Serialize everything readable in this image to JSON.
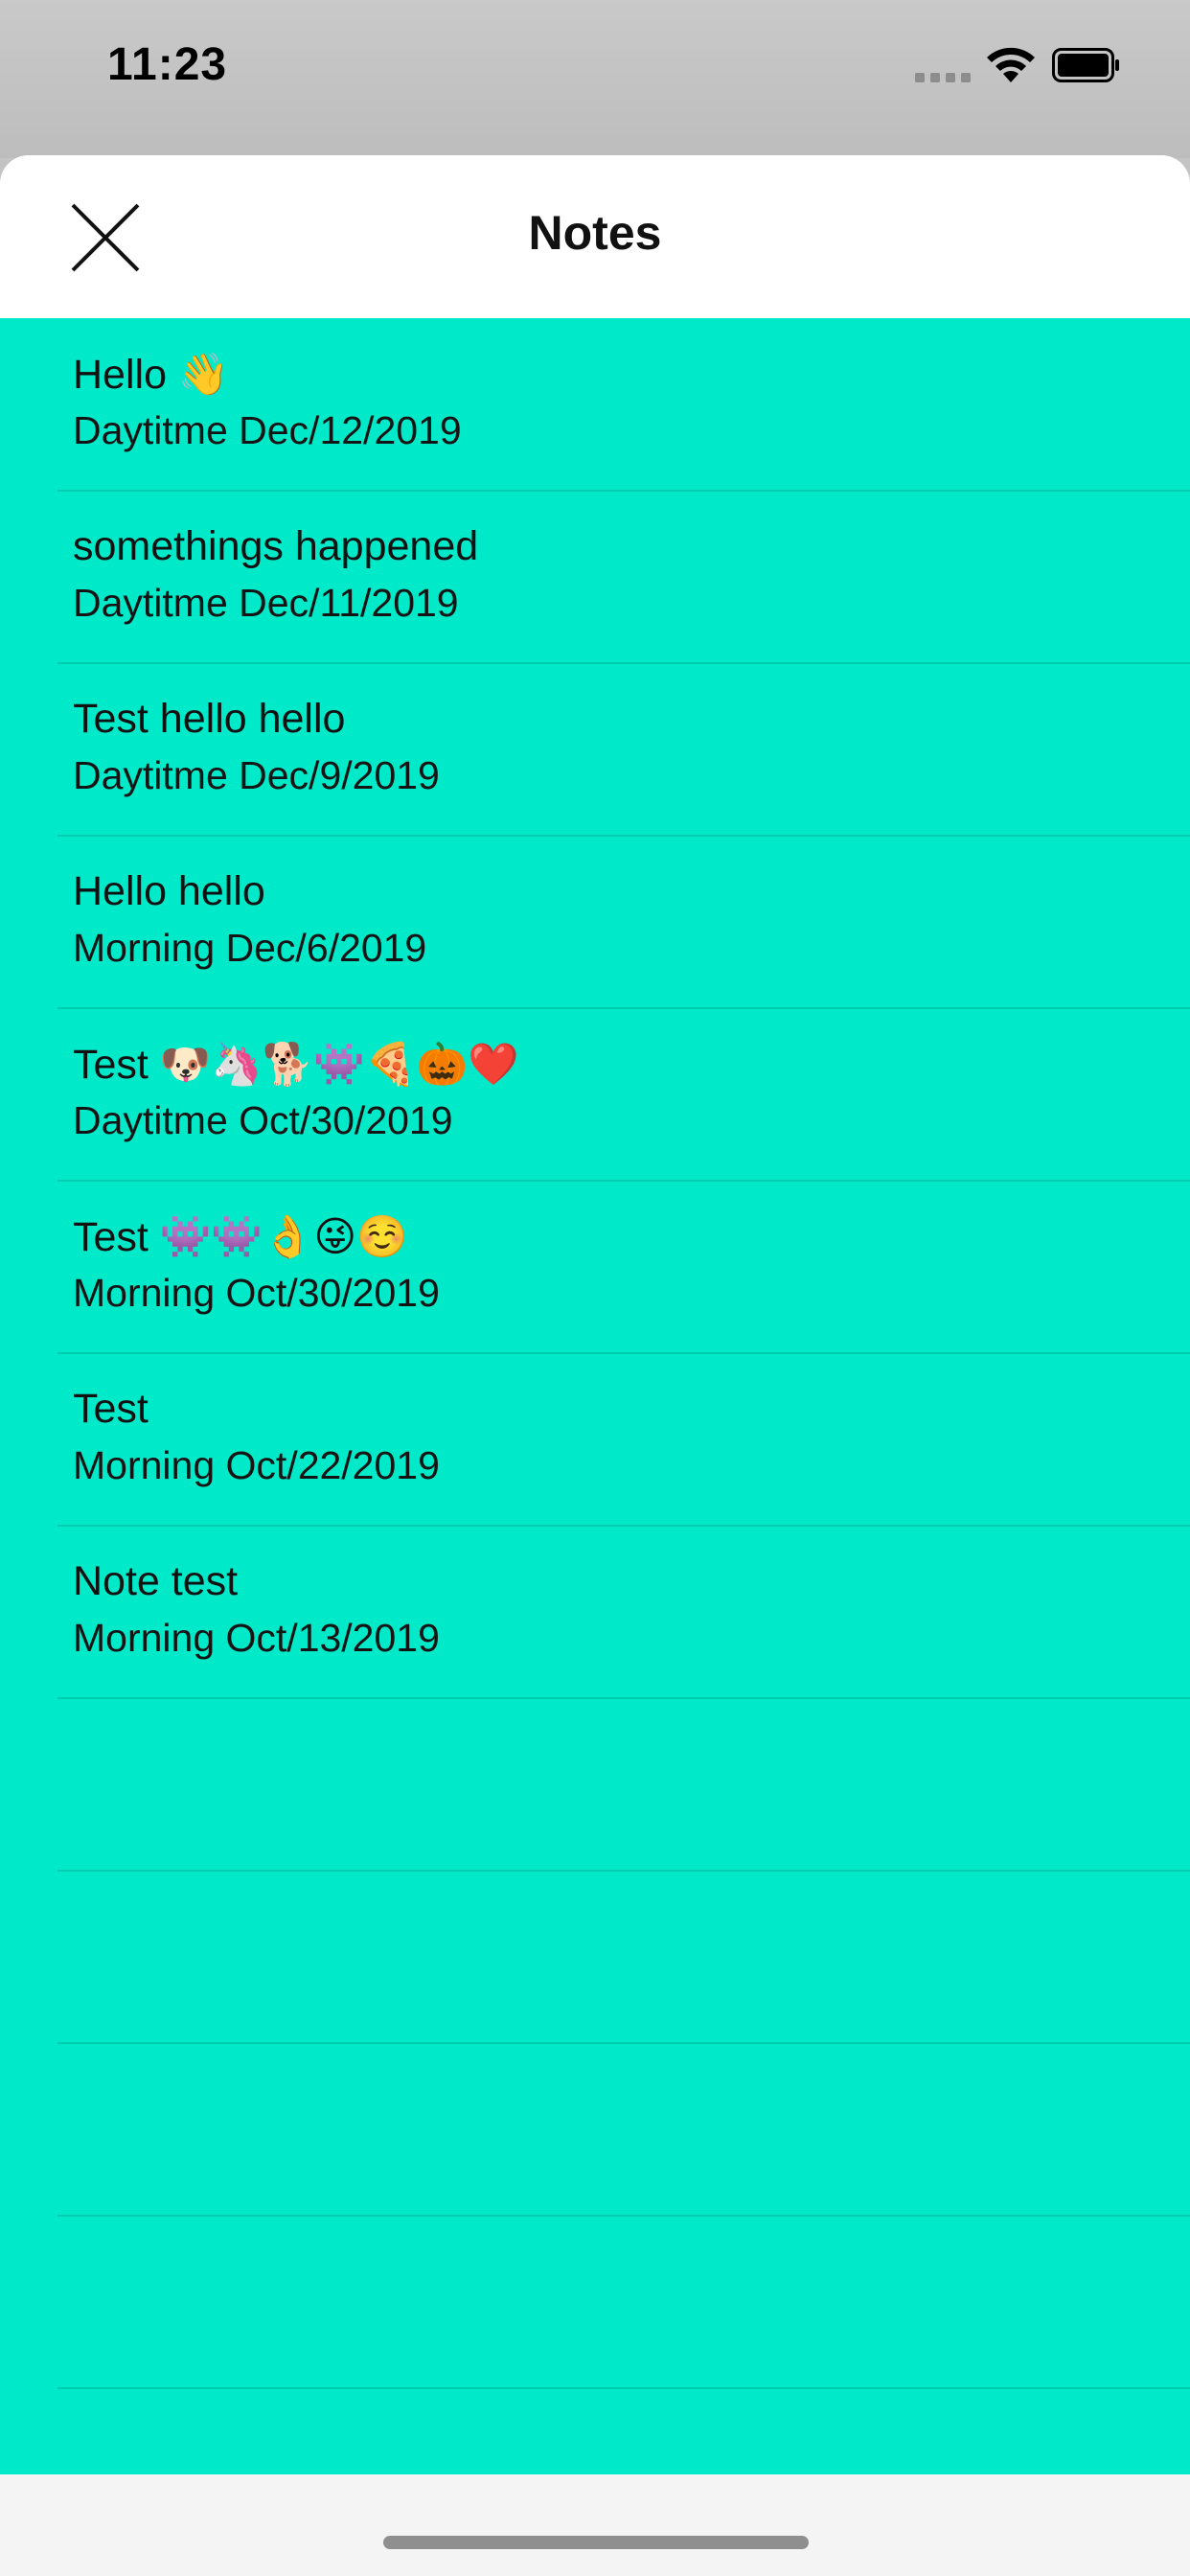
{
  "status_bar": {
    "time": "11:23"
  },
  "nav": {
    "title": "Notes",
    "close_icon": "close-x-icon"
  },
  "notes": [
    {
      "title": "Hello 👋",
      "subtitle": "Daytitme Dec/12/2019"
    },
    {
      "title": "somethings happened",
      "subtitle": "Daytitme Dec/11/2019"
    },
    {
      "title": "Test hello hello",
      "subtitle": "Daytitme Dec/9/2019"
    },
    {
      "title": "Hello hello",
      "subtitle": "Morning Dec/6/2019"
    },
    {
      "title": "Test 🐶🦄🐕👾🍕🎃❤️",
      "subtitle": "Daytitme Oct/30/2019"
    },
    {
      "title": "Test 👾👾👌😜☺️",
      "subtitle": "Morning Oct/30/2019"
    },
    {
      "title": "Test",
      "subtitle": "Morning Oct/22/2019"
    },
    {
      "title": "Note test",
      "subtitle": "Morning Oct/13/2019"
    }
  ],
  "colors": {
    "list_background": "#00e9c9",
    "header_background": "#ffffff",
    "status_bar_background": "#c3c3c3"
  }
}
